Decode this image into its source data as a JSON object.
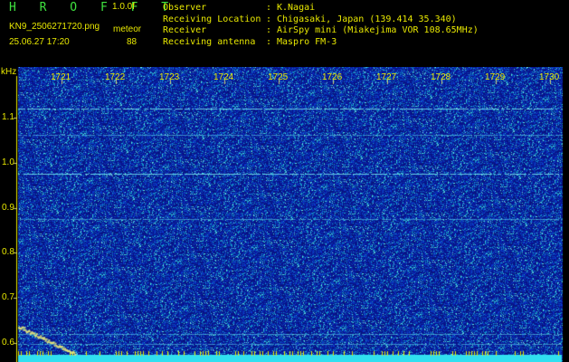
{
  "header": {
    "title": "H R O F F T",
    "version": "1.0.0f",
    "filename": "KN9_2506271720.png",
    "meteor_label": "meteor",
    "datetime": "25.06.27  17:20",
    "count": "88",
    "info": [
      {
        "label": "Observer",
        "value": "K.Nagai"
      },
      {
        "label": "Receiving Location",
        "value": "Chigasaki, Japan (139.414 35.340)"
      },
      {
        "label": "Receiver",
        "value": "AirSpy mini (Miakejima VOR 108.65MHz)"
      },
      {
        "label": "Receiving antenna",
        "value": "Maspro FM-3"
      }
    ]
  },
  "plot": {
    "y_unit": "kHz",
    "x_ticks": [
      "1721",
      "1722",
      "1723",
      "1724",
      "1725",
      "1726",
      "1727",
      "1728",
      "1729",
      "1730"
    ],
    "y_ticks": [
      "1.1",
      "1.0",
      "0.9",
      "0.8",
      "0.7",
      "0.6"
    ],
    "colors": {
      "background": "#000000",
      "noise_dark": "#0a1a8a",
      "noise_light": "#35d7e8",
      "axis": "#e8e800"
    }
  }
}
